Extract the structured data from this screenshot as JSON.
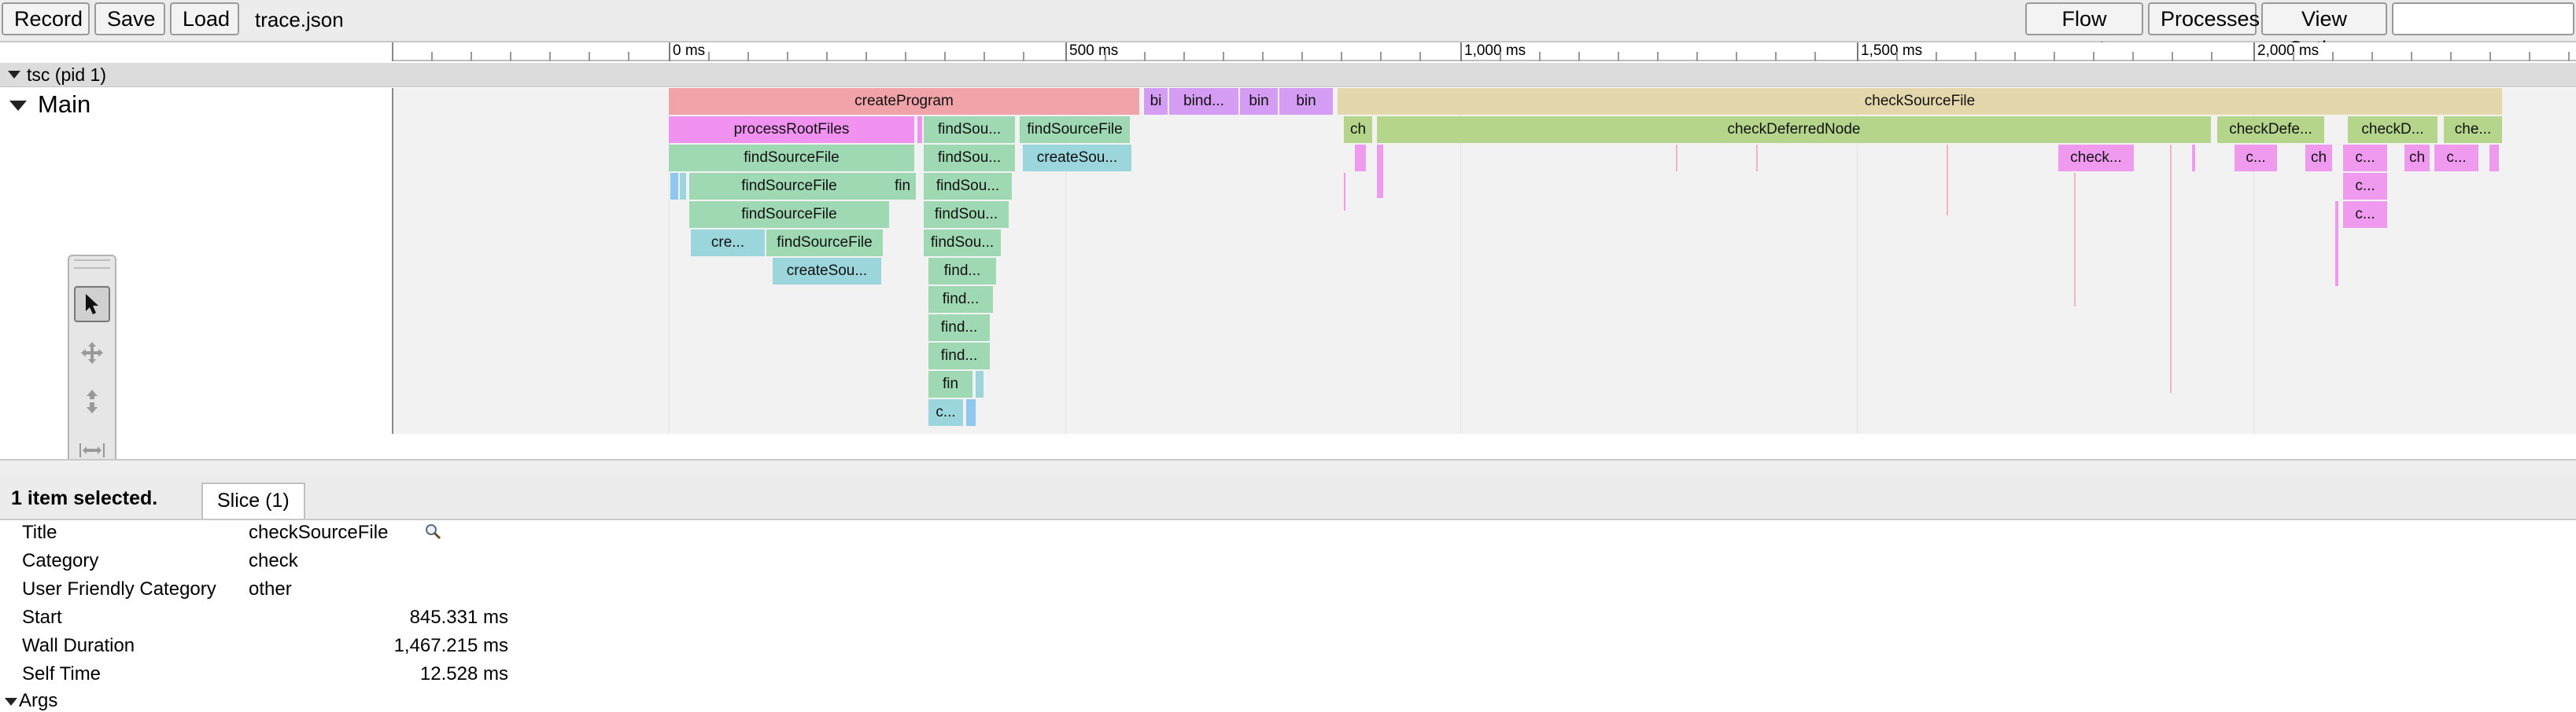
{
  "toolbar": {
    "record_label": "Record",
    "save_label": "Save",
    "load_label": "Load",
    "filename": "trace.json",
    "flow_events_label": "Flow events",
    "processes_label": "Processes",
    "view_options_label": "View Options",
    "search_value": ""
  },
  "ruler": {
    "labels": [
      "0 ms",
      "500 ms",
      "1,000 ms",
      "1,500 ms",
      "2,000 ms"
    ]
  },
  "process": {
    "label": "tsc (pid 1)"
  },
  "thread": {
    "label": "Main"
  },
  "slices": {
    "createProgram": "createProgram",
    "bi": "bi",
    "bind": "bind...",
    "bin1": "bin",
    "bin2": "bin",
    "checkSourceFile": "checkSourceFile",
    "processRootFiles": "processRootFiles",
    "findSou_a": "findSou...",
    "findSourceFile_a": "findSourceFile",
    "ch": "ch",
    "checkDeferredNode": "checkDeferredNode",
    "checkDefe": "checkDefe...",
    "checkD": "checkD...",
    "che": "che...",
    "findSourceFile_b": "findSourceFile",
    "findSou_b": "findSou...",
    "createSou_a": "createSou...",
    "check_a": "check...",
    "c_a": "c...",
    "ch_b": "ch",
    "c_b": "c...",
    "ch_c": "ch",
    "c_c": "c...",
    "findSourceFile_c": "findSourceFile",
    "fin_a": "fin",
    "findSou_c": "findSou...",
    "c_d": "c...",
    "findSourceFile_d": "findSourceFile",
    "findSou_d": "findSou...",
    "c_e": "c...",
    "cre": "cre...",
    "findSourceFile_e": "findSourceFile",
    "findSou_e": "findSou...",
    "createSou_b": "createSou...",
    "find_a": "find...",
    "find_b": "find...",
    "find_c": "find...",
    "find_d": "find...",
    "fin_b": "fin",
    "c_f": "c..."
  },
  "analysis": {
    "selected_text": "1 item selected.",
    "slice_tab": "Slice (1)",
    "props": {
      "title_label": "Title",
      "title_value": "checkSourceFile",
      "category_label": "Category",
      "category_value": "check",
      "ufc_label": "User Friendly Category",
      "ufc_value": "other",
      "start_label": "Start",
      "start_value": "845.331 ms",
      "wall_label": "Wall Duration",
      "wall_value": "1,467.215 ms",
      "self_label": "Self Time",
      "self_value": "12.528 ms",
      "args_label": "Args"
    }
  },
  "colors": {
    "createProgram": "#f0a3a8",
    "bind": "#d49cf2",
    "checkSourceFile": "#e4d7ab",
    "checkDeferredNode": "#b5d58b",
    "processRootFiles": "#f191f0",
    "findSourceFile": "#9ed9b3",
    "createSourceFile": "#9ad6dc",
    "check": "#ef9aef",
    "blue_sliver": "#8fc7ef"
  },
  "icons": {
    "selection_tool": "arrow-pointer-icon",
    "pan_tool": "move-icon",
    "zoom_tool": "zoom-arrows-icon",
    "timing_tool": "timing-icon",
    "search_magnifier": "magnifier-icon"
  }
}
